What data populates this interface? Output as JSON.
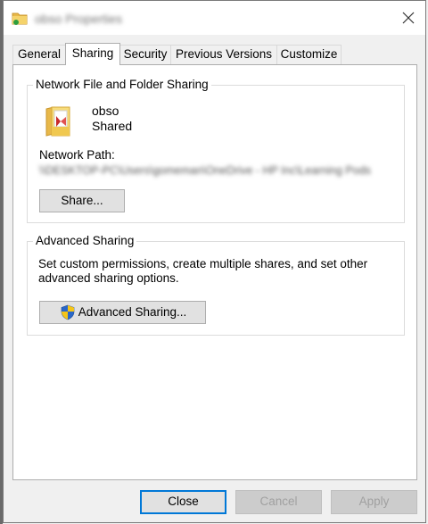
{
  "window": {
    "title": "obso Properties"
  },
  "tabs": [
    {
      "label": "General"
    },
    {
      "label": "Sharing"
    },
    {
      "label": "Security"
    },
    {
      "label": "Previous Versions"
    },
    {
      "label": "Customize"
    }
  ],
  "active_tab": "Sharing",
  "network_sharing": {
    "group_label": "Network File and Folder Sharing",
    "folder_name": "obso",
    "status": "Shared",
    "network_path_label": "Network Path:",
    "network_path_value": "\\\\DESKTOP-PC\\Users\\gomeman\\OneDrive - HP Inc\\Learning Pods",
    "share_button": "Share..."
  },
  "advanced_sharing": {
    "group_label": "Advanced Sharing",
    "description": "Set custom permissions, create multiple shares, and set other advanced sharing options.",
    "button": "Advanced Sharing..."
  },
  "footer": {
    "close": "Close",
    "cancel": "Cancel",
    "apply": "Apply"
  },
  "icons": {
    "title": "folder-icon",
    "folder": "shared-folder-icon",
    "shield": "uac-shield-icon",
    "close": "close-icon"
  },
  "colors": {
    "accent": "#0078d7",
    "folder_yellow": "#e8b84a",
    "shield_blue": "#2a67c8",
    "shield_yellow": "#f5c518"
  }
}
